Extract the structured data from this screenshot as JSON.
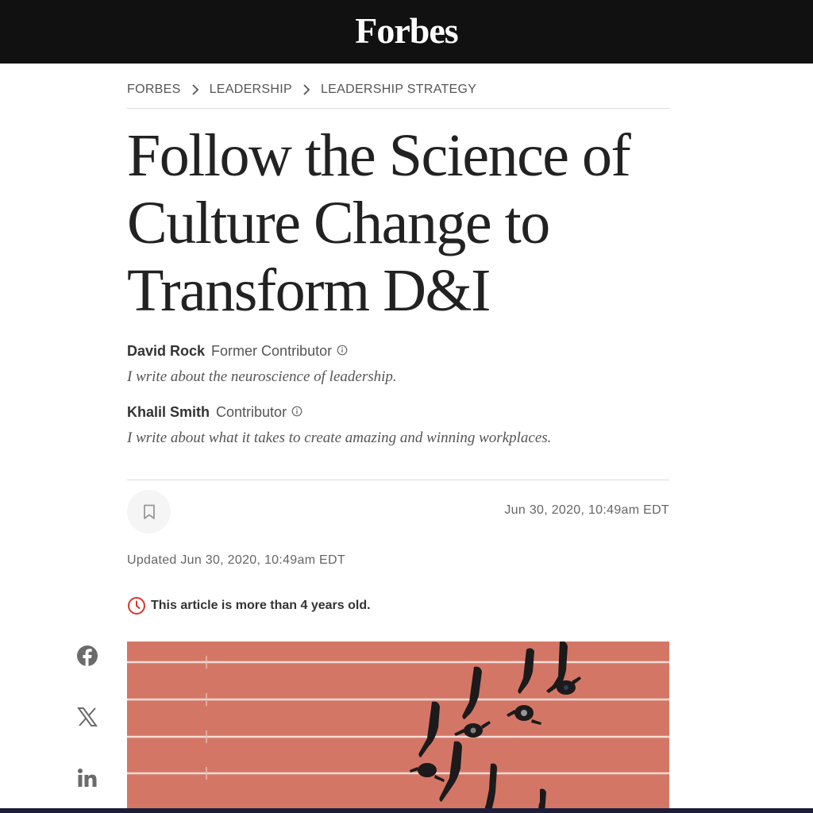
{
  "header": {
    "logo": "Forbes"
  },
  "breadcrumb": {
    "items": [
      "FORBES",
      "LEADERSHIP",
      "LEADERSHIP STRATEGY"
    ]
  },
  "article": {
    "title_lines": [
      "Follow the Science of",
      "Culture Change to",
      "Transform D&I"
    ],
    "authors": [
      {
        "name": "David Rock",
        "role": "Former Contributor",
        "bio": "I write about the neuroscience of leadership."
      },
      {
        "name": "Khalil Smith",
        "role": "Contributor",
        "bio": "I write about what it takes to create amazing and winning workplaces."
      }
    ],
    "published": "Jun 30, 2020, 10:49am EDT",
    "updated": "Updated Jun 30, 2020, 10:49am EDT",
    "age_warning": "This article is more than 4 years old."
  },
  "share": {
    "icons": [
      "facebook-icon",
      "x-icon",
      "linkedin-icon"
    ]
  },
  "colors": {
    "topbar": "#111111",
    "warning": "#d33a2c",
    "track": "#d97a6a"
  }
}
